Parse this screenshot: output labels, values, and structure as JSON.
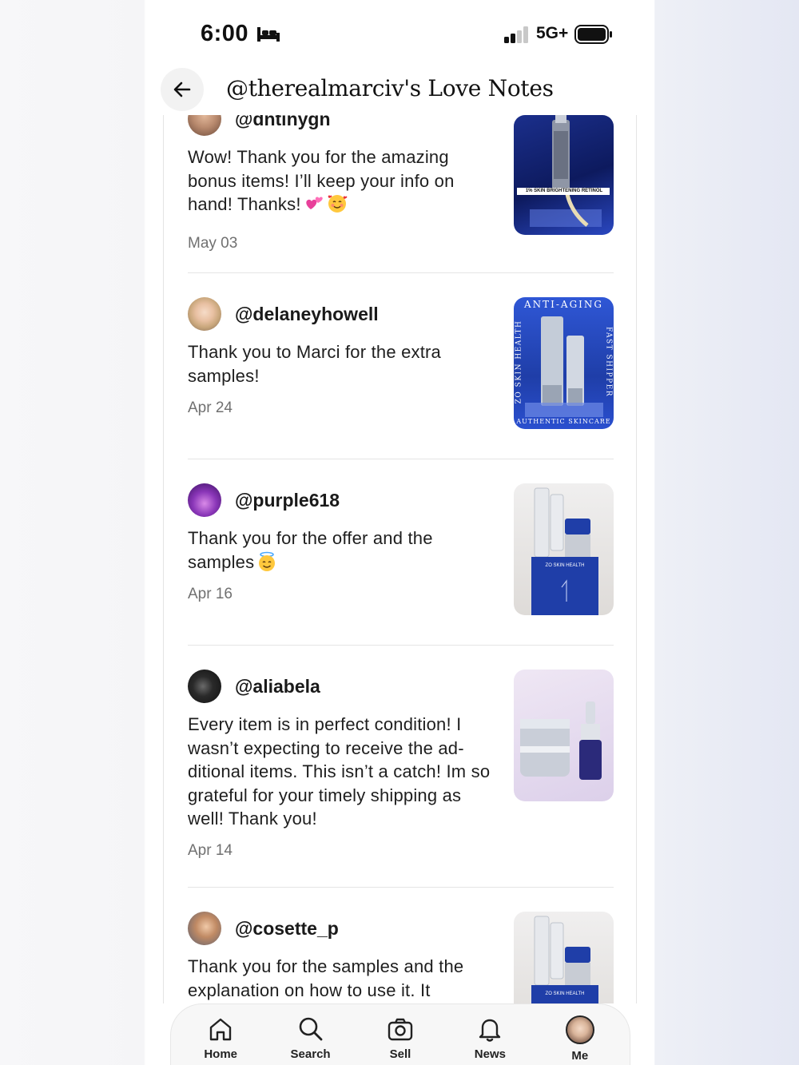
{
  "status_bar": {
    "time": "6:00",
    "network": "5G+"
  },
  "header": {
    "title": "@therealmarciv's Love Notes"
  },
  "notes": [
    {
      "username": "@dntinygn",
      "message": "Wow! Thank you for the amazing bonus items! I’ll keep your info on hand! Thanks!",
      "emojis": [
        "two-hearts",
        "smiling-face-with-hearts"
      ],
      "date": "May 03",
      "thumb_text": "1% SKIN BRIGHTENING RETINOL"
    },
    {
      "username": "@delaneyhowell",
      "message": "Thank you to Marci for the extra samples!",
      "date": "Apr 24",
      "thumb_top": "ANTI-AGING",
      "thumb_left": "ZO SKIN HEALTH",
      "thumb_right": "FAST SHIPPER",
      "thumb_bottom": "AUTHENTIC SKINCARE"
    },
    {
      "username": "@purple618",
      "message": "Thank you for the offer and the samples",
      "emojis": [
        "smiling-face-with-halo"
      ],
      "date": "Apr 16",
      "thumb_text": "ZO SKIN HEALTH"
    },
    {
      "username": "@aliabela",
      "message": "Every item is in perfect condition! I wasn’t expecting to receive the ad-ditional items. This isn’t a catch! Im so grateful for your timely shipping as well! Thank you!",
      "date": "Apr 14"
    },
    {
      "username": "@cosette_p",
      "message": "Thank you for the samples and the explanation on how to use it. It",
      "date": "",
      "thumb_text": "ZO SKIN HEALTH"
    }
  ],
  "tabbar": {
    "items": [
      {
        "label": "Home",
        "icon": "home-icon"
      },
      {
        "label": "Search",
        "icon": "search-icon"
      },
      {
        "label": "Sell",
        "icon": "camera-icon"
      },
      {
        "label": "News",
        "icon": "bell-icon"
      },
      {
        "label": "Me",
        "icon": "profile-avatar"
      }
    ]
  },
  "colors": {
    "text": "#1e1e1e",
    "muted": "#707070",
    "divider": "#e5e5e5",
    "product_blue": "#1f3ea8"
  }
}
